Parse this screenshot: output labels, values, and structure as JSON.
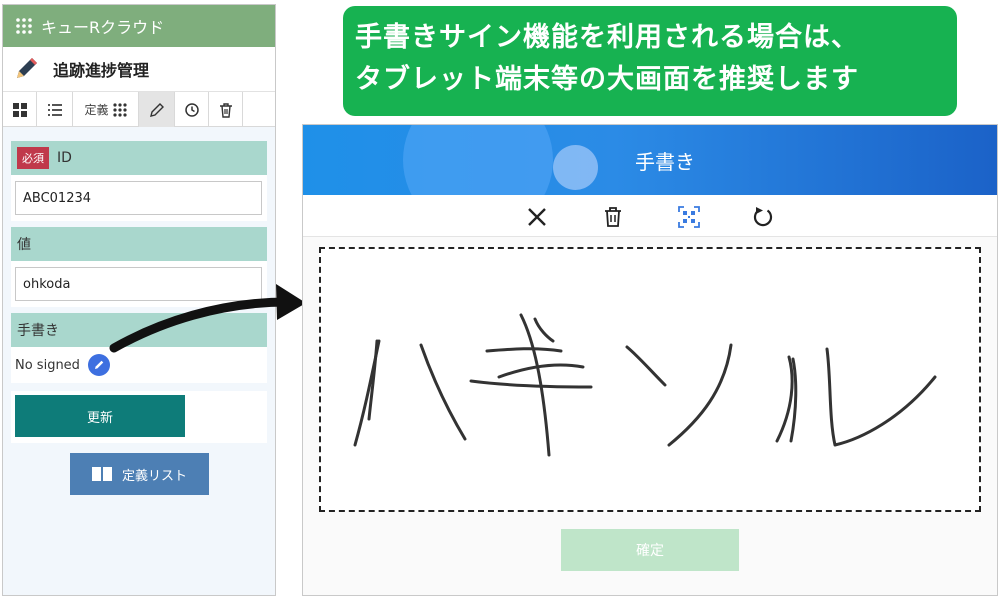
{
  "phone": {
    "app_name": "キューRクラウド",
    "page_title": "追跡進捗管理",
    "toolbar": {
      "definition_label": "定義"
    },
    "fields": [
      {
        "required_badge": "必須",
        "label": "ID",
        "value": "ABC01234"
      },
      {
        "label": "値",
        "value": "ohkoda"
      }
    ],
    "signature": {
      "label": "手書き",
      "status": "No signed"
    },
    "update_button": "更新",
    "definition_list_button": "定義リスト"
  },
  "callout": {
    "line1": "手書きサイン機能を利用される場合は、",
    "line2": "タブレット端末等の大画面を推奨します"
  },
  "modal": {
    "title": "手書き",
    "confirm_button": "確定",
    "tools": [
      "close-icon",
      "trash-icon",
      "qr-scan-icon",
      "rotate-icon"
    ]
  },
  "colors": {
    "header_green": "#7fae7d",
    "label_teal": "#a9d7cd",
    "required_red": "#c0394b",
    "update_teal": "#0e7c79",
    "list_blue": "#4d7fb4",
    "callout_green": "#17b251",
    "modal_blue": "#1f90e8",
    "confirm_green": "#bfe5c9"
  }
}
